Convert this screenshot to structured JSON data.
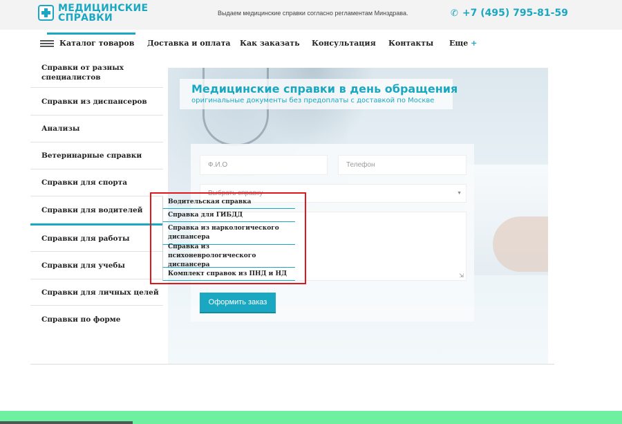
{
  "header": {
    "logo_line1": "МЕДИЦИНСКИЕ",
    "logo_line2": "СПРАВКИ",
    "tagline": "Выдаем медицинские справки согласно регламентам Минздрава.",
    "phone": "+7 (495) 795-81-59",
    "colors": {
      "accent": "#1aa7c1",
      "topbar": "#f3f3f3"
    }
  },
  "nav": {
    "items": [
      "Каталог товаров",
      "Доставка и оплата",
      "Как заказать",
      "Консультация",
      "Контакты",
      "Еще"
    ]
  },
  "sidebar": {
    "items": [
      "Справки от разных специалистов",
      "Справки из диспансеров",
      "Анализы",
      "Ветеринарные справки",
      "Справки для спорта",
      "Справки для водителей",
      "Справки для работы",
      "Справки для учебы",
      "Справки для личных целей",
      "Справки по форме"
    ],
    "active_index": 5
  },
  "banner": {
    "title": "Медицинские справки в день обращения",
    "subtitle": "оригинальные документы без предоплаты с доставкой по Москве"
  },
  "form": {
    "name_placeholder": "Ф.И.О",
    "phone_placeholder": "Телефон",
    "select_placeholder": "Выбрать справку",
    "submit_label": "Оформить заказ"
  },
  "dropdown": {
    "items": [
      "Водительская справка",
      "Справка для ГИБДД",
      "Справка из наркологического диспансера",
      "Справка из психоневрологического диспансера",
      "Комплект справок из ПНД и НД"
    ]
  },
  "footer": {
    "color": "#6ff0a1"
  }
}
